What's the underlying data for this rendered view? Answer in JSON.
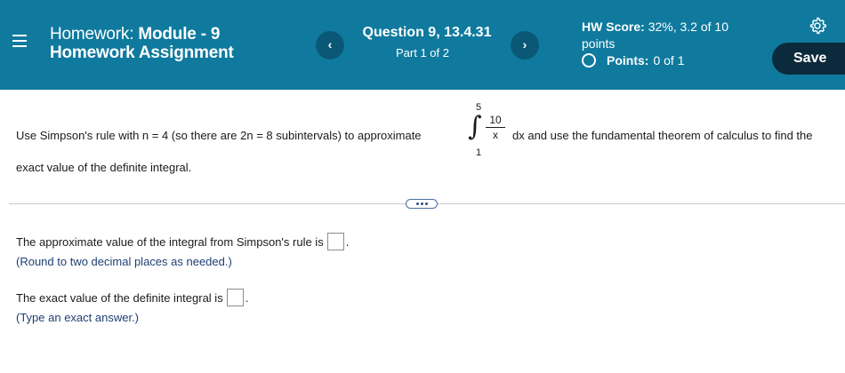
{
  "header": {
    "title_prefix": "Homework: ",
    "title_module": "Module - 9",
    "title_line2": "Homework Assignment",
    "question_title": "Question 9, 13.4.31",
    "part": "Part 1 of 2",
    "score_label": "HW Score:",
    "score_value": "32%, 3.2 of 10",
    "score_suffix": "points",
    "points_label": "Points:",
    "points_value": "0 of 1",
    "save_label": "Save",
    "prev_glyph": "‹",
    "next_glyph": "›",
    "icons": {
      "menu": "menu-icon",
      "settings": "gear-icon"
    }
  },
  "question": {
    "text_before": "Use Simpson's rule with n = 4 (so there are 2n = 8 subintervals) to approximate",
    "integral_upper": "5",
    "integral_lower": "1",
    "integral_numerator": "10",
    "integral_denominator": "x",
    "text_after": "dx and use the fundamental theorem of calculus to find the",
    "text_continued": "exact value of the definite integral."
  },
  "answers": [
    {
      "label": "The approximate value of the integral from Simpson's rule is",
      "hint": "(Round to two decimal places as needed.)",
      "value": ""
    },
    {
      "label": "The exact value of the definite integral is",
      "hint": "(Type an exact answer.)",
      "value": ""
    }
  ],
  "colors": {
    "header": "#0f7a9e",
    "nav_button": "#0b5876",
    "save_button": "#0b2a3b",
    "hint_text": "#1f3f73"
  }
}
